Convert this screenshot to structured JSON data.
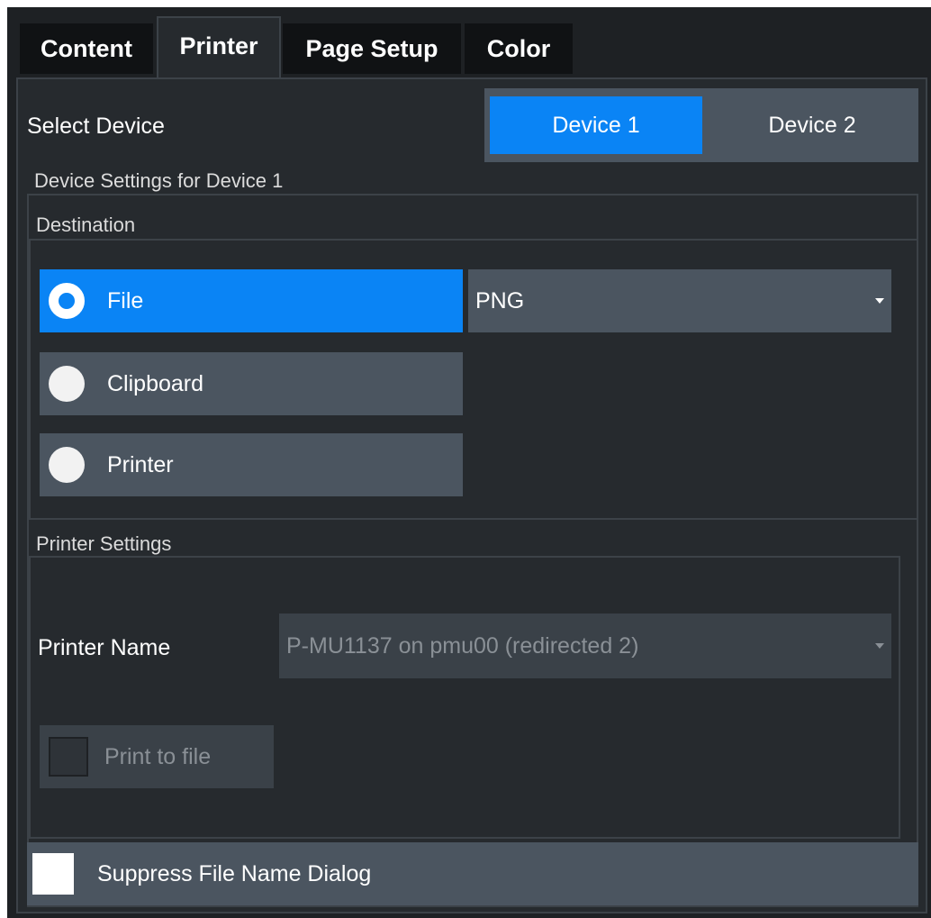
{
  "tabs": [
    {
      "label": "Content"
    },
    {
      "label": "Printer"
    },
    {
      "label": "Page Setup"
    },
    {
      "label": "Color"
    }
  ],
  "select_device": {
    "label": "Select Device",
    "options": [
      {
        "label": "Device 1"
      },
      {
        "label": "Device 2"
      }
    ],
    "selected": "Device 1"
  },
  "device_settings": {
    "title": "Device Settings for Device 1",
    "destination": {
      "title": "Destination",
      "options": [
        {
          "label": "File",
          "selected": true
        },
        {
          "label": "Clipboard",
          "selected": false
        },
        {
          "label": "Printer",
          "selected": false
        }
      ],
      "file_format": "PNG"
    },
    "printer_settings": {
      "title": "Printer Settings",
      "printer_name_label": "Printer Name",
      "printer_name_value": "P-MU1137 on pmu00 (redirected 2)",
      "print_to_file_label": "Print to file"
    }
  },
  "suppress_dialog": {
    "label": "Suppress File Name Dialog",
    "checked": false
  },
  "colors": {
    "accent": "#0a84f5",
    "background": "#262a2e",
    "control": "#4b5560"
  }
}
